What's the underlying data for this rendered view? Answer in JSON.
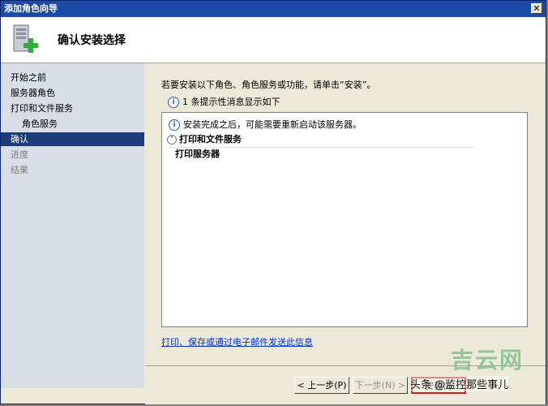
{
  "window": {
    "title": "添加角色向导",
    "close_symbol": "✕"
  },
  "header": {
    "title": "确认安装选择",
    "icon": "server-add-icon"
  },
  "nav": {
    "items": [
      {
        "label": "开始之前",
        "state": "normal"
      },
      {
        "label": "服务器角色",
        "state": "normal"
      },
      {
        "label": "打印和文件服务",
        "state": "normal"
      },
      {
        "label": "角色服务",
        "state": "normal"
      },
      {
        "label": "确认",
        "state": "active"
      },
      {
        "label": "进度",
        "state": "disabled"
      },
      {
        "label": "结果",
        "state": "disabled"
      }
    ]
  },
  "content": {
    "intro": "若要安装以下角色、角色服务或功能，请单击“安装”。",
    "info_count_line": "1 条提示性消息显示如下",
    "listbox": {
      "note": "安装完成之后，可能需要重新启动该服务器。",
      "section": "打印和文件服务",
      "child": "打印服务器"
    },
    "link": "打印、保存或通过电子邮件发送此信息"
  },
  "footer": {
    "prev_label": "< 上一步(P)",
    "next_label": "下一步(N) >",
    "install_label": "安装(I)"
  },
  "watermark": {
    "logo_text": "吉云网",
    "caption": "头条 @监控那些事儿"
  },
  "colors": {
    "titlebar": "#1c4aa8",
    "nav_bg": "#d8dde6",
    "nav_active": "#1c3c7a",
    "highlight": "#cc1f1f"
  }
}
